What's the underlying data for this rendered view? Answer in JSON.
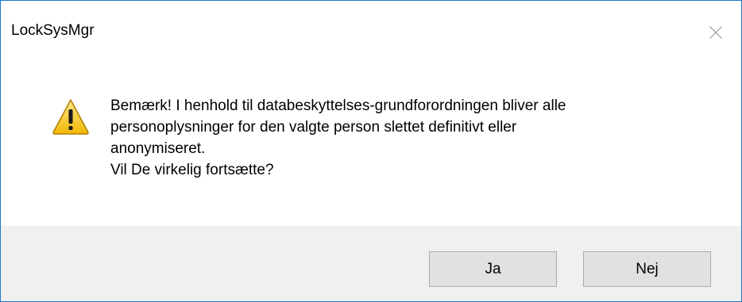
{
  "window": {
    "title": "LockSysMgr"
  },
  "icons": {
    "close": "close-icon",
    "warning": "warning-icon"
  },
  "message": {
    "lines": [
      "Bemærk! I henhold til databeskyttelses-grundforordningen bliver alle",
      "personoplysninger for den valgte person slettet definitivt eller",
      "anonymiseret.",
      "Vil De virkelig fortsætte?"
    ]
  },
  "buttons": {
    "yes_label": "Ja",
    "no_label": "Nej"
  },
  "colors": {
    "window_border": "#1979ca",
    "footer_background": "#f0f0f0",
    "button_background": "#e1e1e1",
    "warning_fill": "#f4c20d"
  }
}
